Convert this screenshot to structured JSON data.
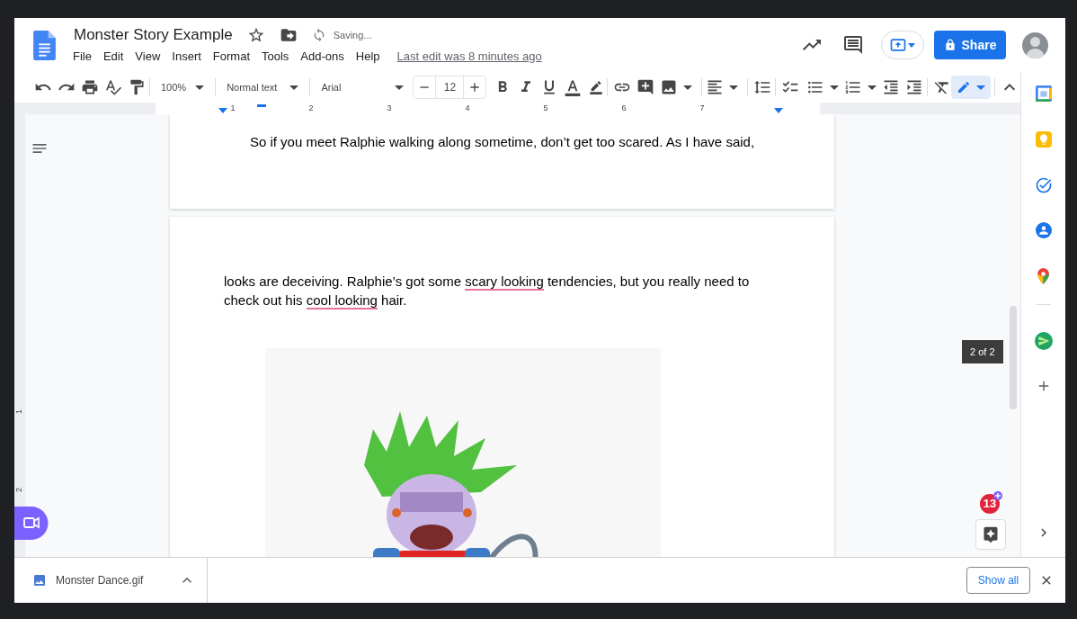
{
  "document": {
    "title": "Monster Story Example",
    "status": "Saving...",
    "last_edit": "Last edit was 8 minutes ago"
  },
  "menu": [
    "File",
    "Edit",
    "View",
    "Insert",
    "Format",
    "Tools",
    "Add-ons",
    "Help"
  ],
  "share_button": "Share",
  "toolbar": {
    "zoom": "100%",
    "style": "Normal text",
    "font": "Arial",
    "font_size": "12"
  },
  "ruler": [
    "1",
    "2",
    "3",
    "4",
    "5",
    "6",
    "7"
  ],
  "vertical_ruler": [
    "1",
    "2"
  ],
  "pages": [
    {
      "paragraphs": [
        [
          {
            "text": "So if you meet Ralphie walking along sometime, don’t get too scared. As I have said,",
            "flagged": false
          }
        ]
      ]
    },
    {
      "paragraphs": [
        [
          {
            "text": "looks are deceiving. Ralphie’s got some ",
            "flagged": false
          },
          {
            "text": "scary looking",
            "flagged": true
          },
          {
            "text": " tendencies, but you really need to check out his ",
            "flagged": false
          },
          {
            "text": "cool looking",
            "flagged": true
          },
          {
            "text": " hair.",
            "flagged": false
          }
        ]
      ],
      "image": {
        "kind": "picture"
      }
    }
  ],
  "page_indicator": "2 of 2",
  "notification_badge": "13",
  "downloads": {
    "file": "Monster Dance.gif",
    "show_all": "Show all"
  }
}
